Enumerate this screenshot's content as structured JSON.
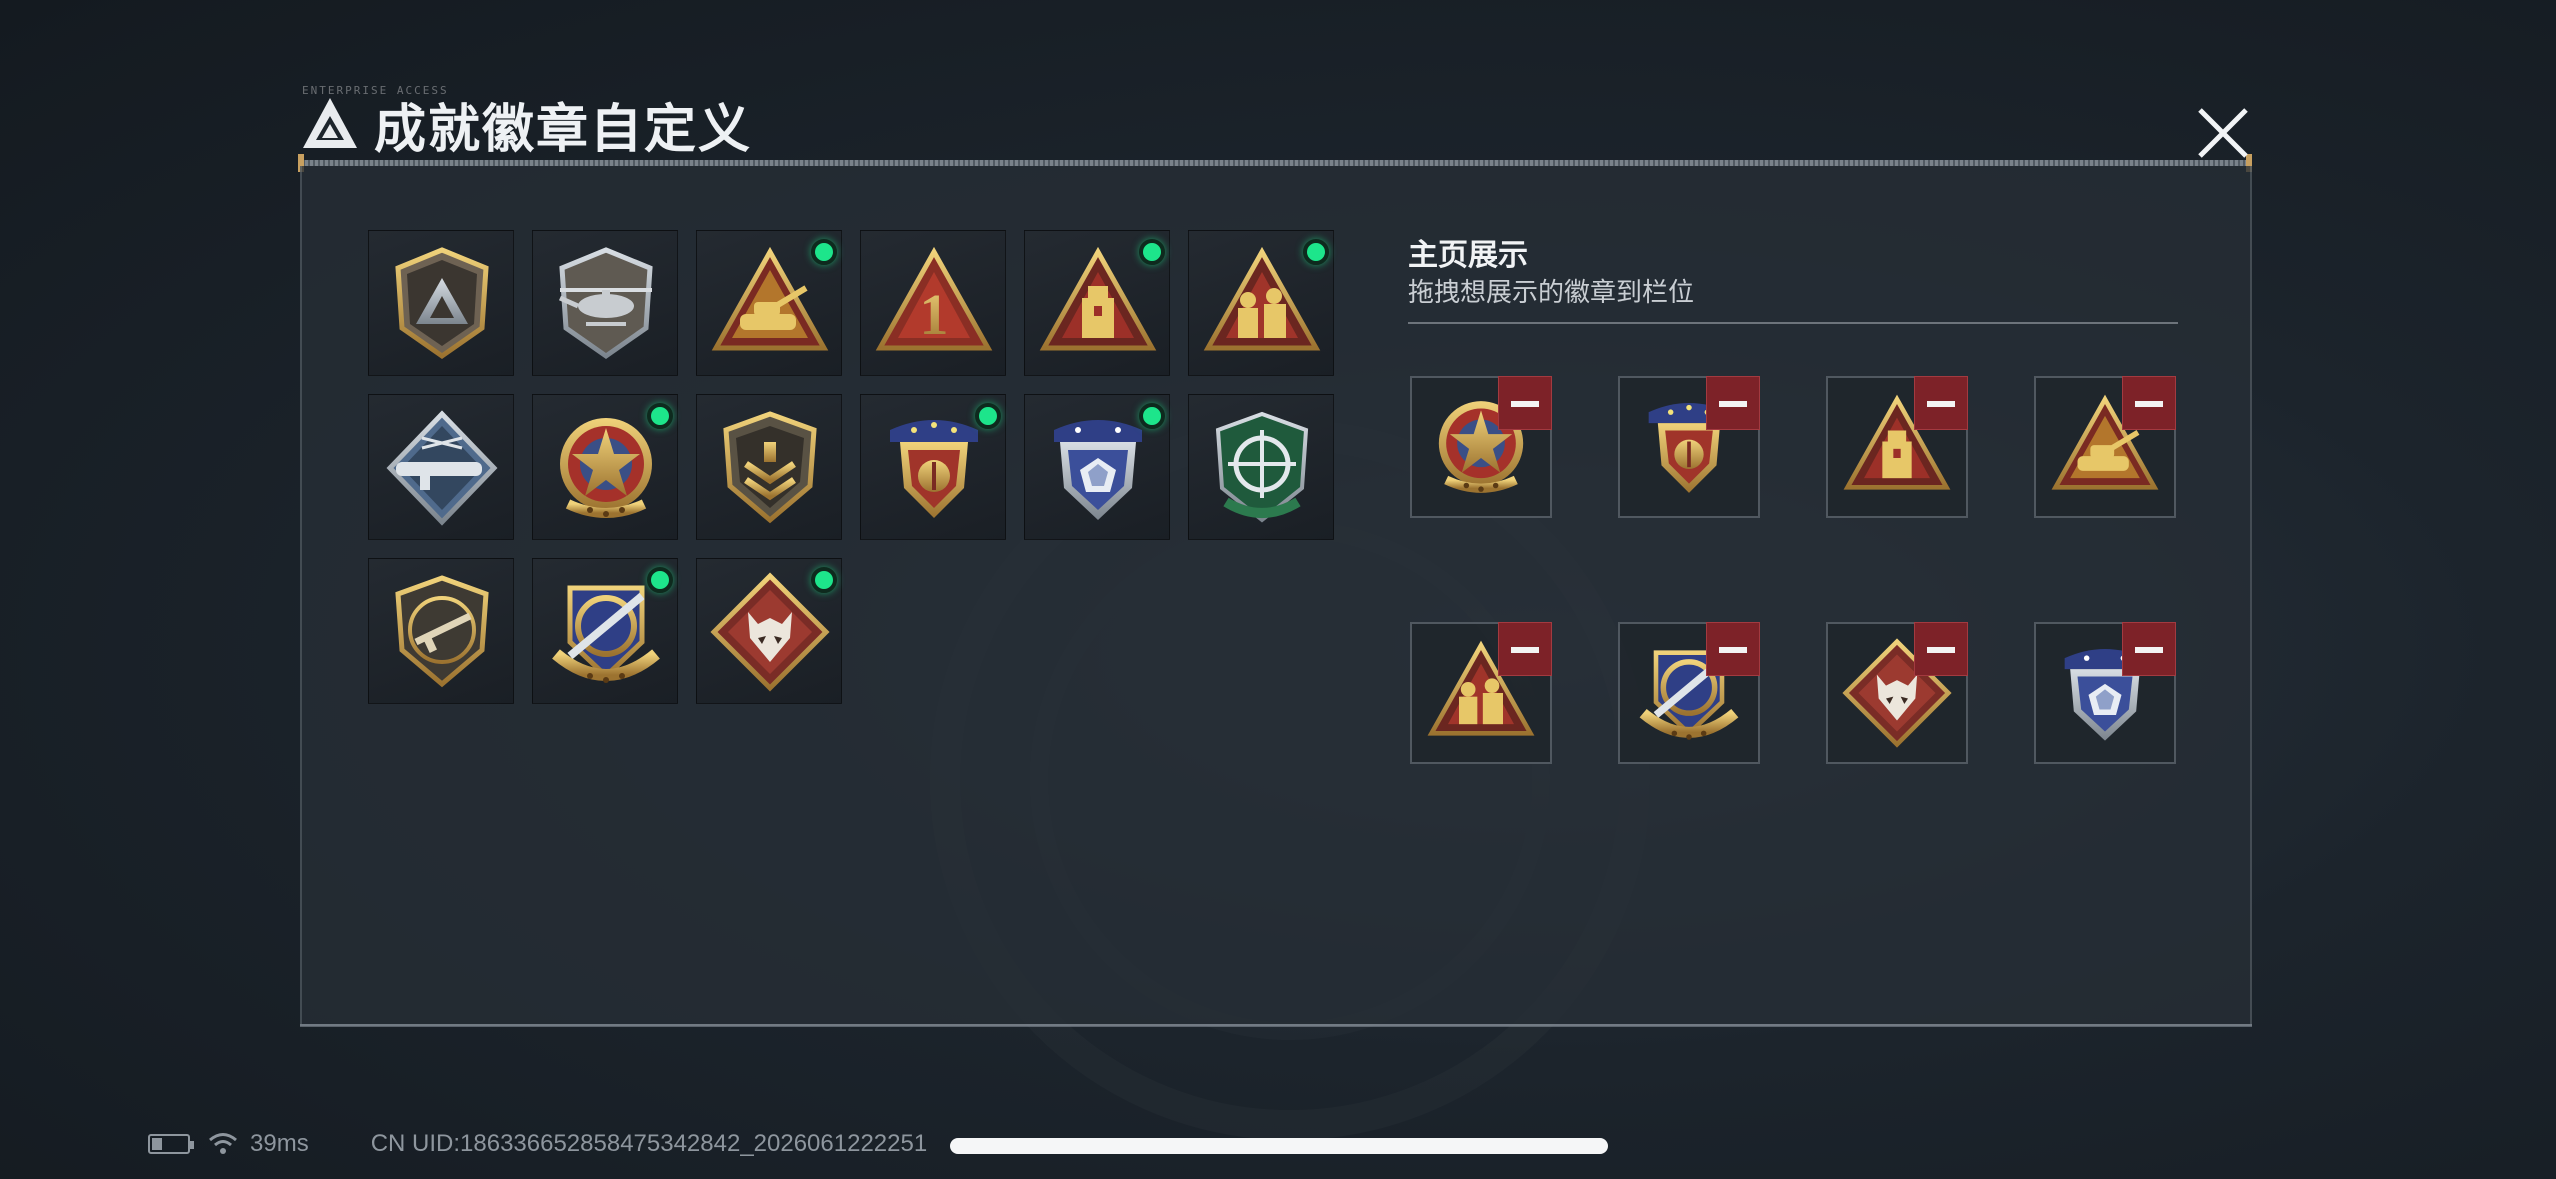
{
  "window": {
    "title": "成就徽章自定义",
    "micro_label": "ENTERPRISE ACCESS"
  },
  "owned_badges": [
    {
      "icon": "mountain-shield-badge-icon",
      "new": false
    },
    {
      "icon": "helicopter-badge-icon",
      "new": false
    },
    {
      "icon": "tank-triangle-badge-icon",
      "new": true
    },
    {
      "icon": "number-one-triangle-badge-icon",
      "new": false
    },
    {
      "icon": "soldier-triangle-badge-icon",
      "new": true
    },
    {
      "icon": "squad-triangle-badge-icon",
      "new": true
    },
    {
      "icon": "rocket-launcher-diamond-badge-icon",
      "new": false
    },
    {
      "icon": "star-wreath-badge-icon",
      "new": true
    },
    {
      "icon": "chevron-shield-badge-icon",
      "new": false
    },
    {
      "icon": "laurel-shield-badge-icon",
      "new": true
    },
    {
      "icon": "gem-shield-badge-icon",
      "new": true
    },
    {
      "icon": "crosshair-green-shield-badge-icon",
      "new": false
    },
    {
      "icon": "rifle-shield-badge-icon",
      "new": false
    },
    {
      "icon": "target-sword-badge-icon",
      "new": true
    },
    {
      "icon": "wolf-diamond-badge-icon",
      "new": true
    }
  ],
  "showcase": {
    "title": "主页展示",
    "subtitle": "拖拽想展示的徽章到栏位",
    "slots": [
      {
        "icon": "star-wreath-badge-icon"
      },
      {
        "icon": "laurel-shield-badge-icon"
      },
      {
        "icon": "soldier-triangle-badge-icon"
      },
      {
        "icon": "tank-triangle-badge-icon"
      },
      {
        "icon": "squad-triangle-badge-icon"
      },
      {
        "icon": "target-sword-badge-icon"
      },
      {
        "icon": "wolf-diamond-badge-icon"
      },
      {
        "icon": "gem-shield-badge-icon"
      }
    ]
  },
  "status_bar": {
    "ping": "39ms",
    "uid": "CN UID:18633665285847534​2842_2026061222251"
  },
  "colors": {
    "accent_green": "#1de58b",
    "remove_red": "#7d2228",
    "gold": "#c8a060"
  }
}
